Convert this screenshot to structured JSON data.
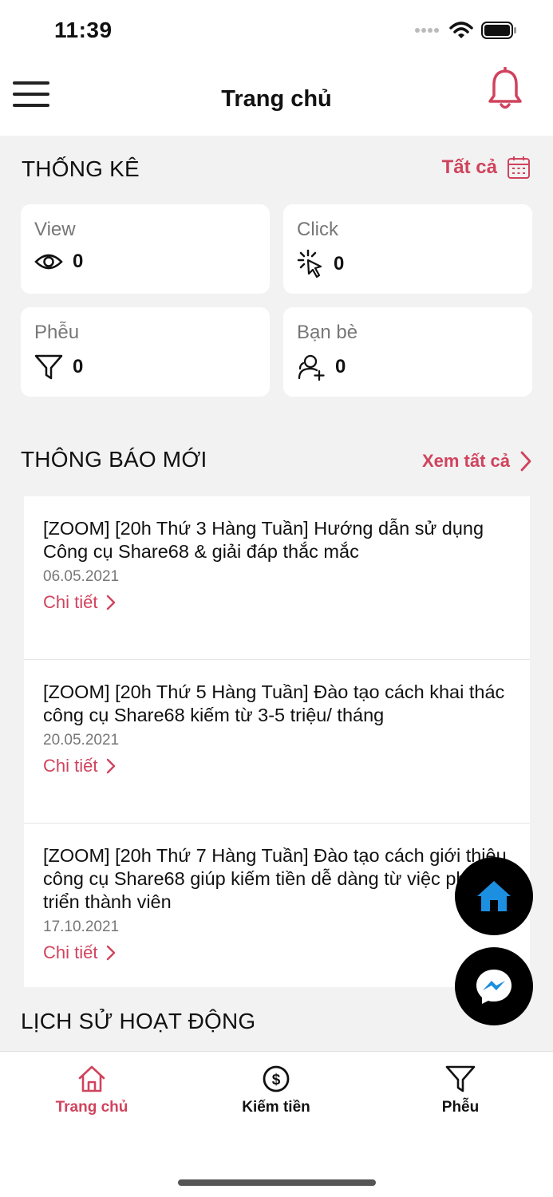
{
  "status_bar": {
    "time": "11:39"
  },
  "header": {
    "title": "Trang chủ"
  },
  "stats": {
    "title": "THỐNG KÊ",
    "filter_label": "Tất cả",
    "cards": [
      {
        "label": "View",
        "value": "0",
        "icon": "eye-icon"
      },
      {
        "label": "Click",
        "value": "0",
        "icon": "cursor-click-icon"
      },
      {
        "label": "Phễu",
        "value": "0",
        "icon": "funnel-icon"
      },
      {
        "label": "Bạn bè",
        "value": "0",
        "icon": "add-friend-icon"
      }
    ]
  },
  "notices": {
    "title": "THÔNG BÁO MỚI",
    "see_all": "Xem tất cả",
    "items": [
      {
        "title": "[ZOOM] [20h Thứ 3 Hàng Tuần] Hướng dẫn sử dụng Công cụ Share68 & giải đáp thắc mắc",
        "date": "06.05.2021",
        "link": "Chi tiết"
      },
      {
        "title": "[ZOOM] [20h Thứ 5 Hàng Tuần] Đào tạo cách khai thác công cụ Share68 kiếm từ 3-5 triệu/ tháng",
        "date": "20.05.2021",
        "link": "Chi tiết"
      },
      {
        "title": "[ZOOM] [20h Thứ 7 Hàng Tuần] Đào tạo cách giới thiệu công cụ Share68 giúp kiếm tiền dễ dàng từ việc phát triển thành viên",
        "date": "17.10.2021",
        "link": "Chi tiết"
      }
    ]
  },
  "history": {
    "title": "LỊCH SỬ HOẠT ĐỘNG"
  },
  "tabs": [
    {
      "label": "Trang chủ",
      "active": true
    },
    {
      "label": "Kiếm tiền",
      "active": false
    },
    {
      "label": "Phễu",
      "active": false
    }
  ],
  "colors": {
    "accent": "#d0435d",
    "background": "#f2f2f2",
    "fab": "#000000",
    "home_fab_icon": "#1d8fe0"
  }
}
